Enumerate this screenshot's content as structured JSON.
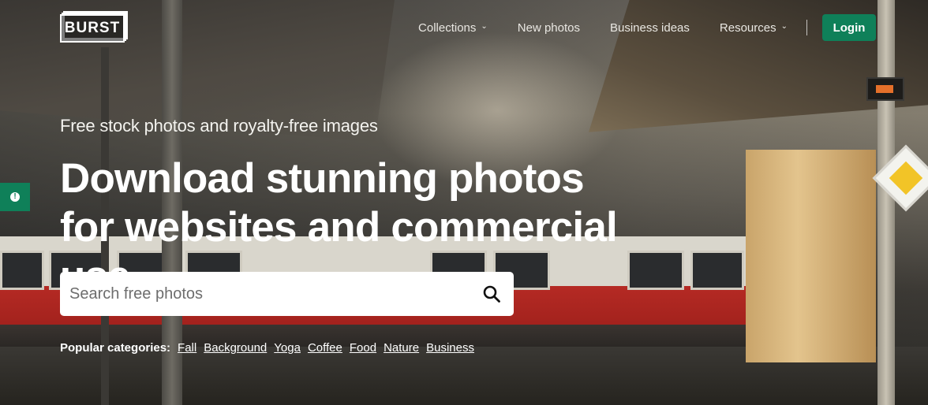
{
  "header": {
    "logo_text": "BURST",
    "nav": [
      {
        "label": "Collections",
        "has_dropdown": true
      },
      {
        "label": "New photos",
        "has_dropdown": false
      },
      {
        "label": "Business ideas",
        "has_dropdown": false
      },
      {
        "label": "Resources",
        "has_dropdown": true
      }
    ],
    "login_label": "Login",
    "dropdown_icon": "chevron-down-icon"
  },
  "feedback_tab": {
    "icon": "info-icon",
    "glyph": "!"
  },
  "hero": {
    "eyebrow": "Free stock photos and royalty-free images",
    "headline": "Download stunning photos for websites and commercial use"
  },
  "search": {
    "placeholder": "Search free photos",
    "value": "",
    "icon": "search-icon"
  },
  "popular": {
    "label": "Popular categories:",
    "items": [
      "Fall",
      "Background",
      "Yoga",
      "Coffee",
      "Food",
      "Nature",
      "Business"
    ]
  },
  "colors": {
    "accent": "#0f8059",
    "text": "#ffffff"
  }
}
